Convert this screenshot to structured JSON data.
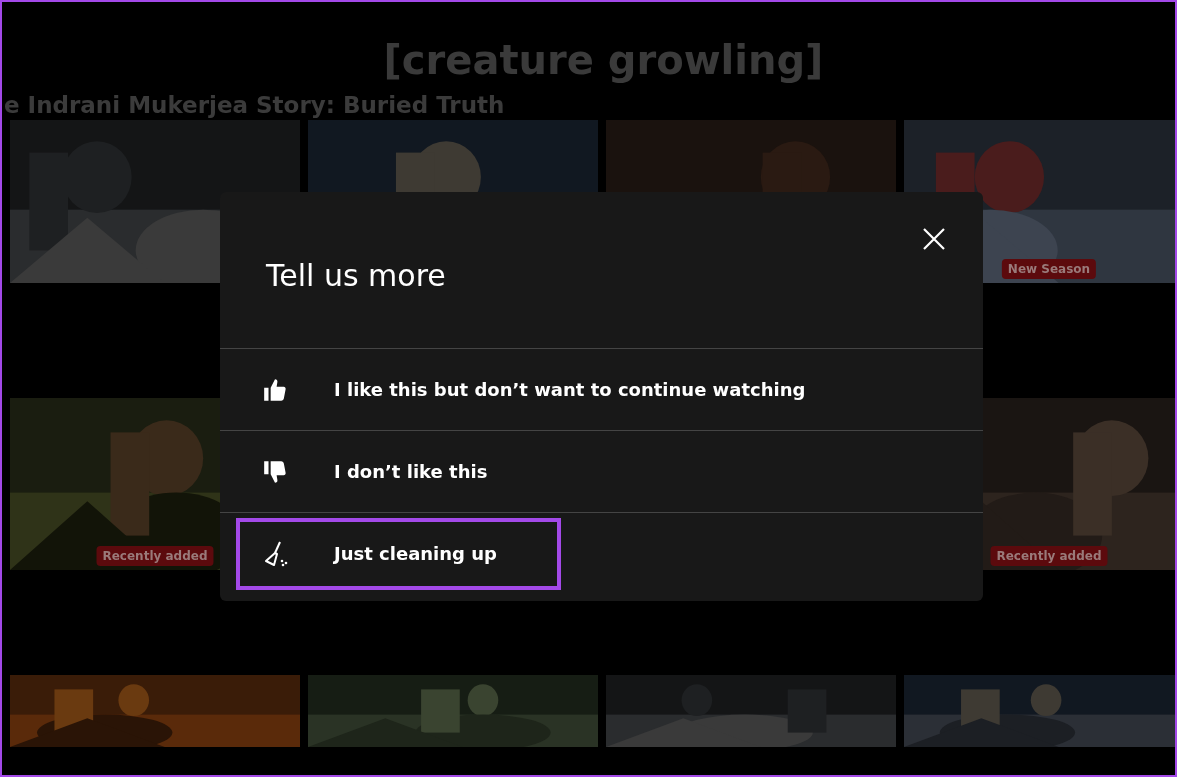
{
  "subtitle": "[creature growling]",
  "row_title": "e Indrani Mukerjea Story: Buried Truth",
  "rows": [
    {
      "tiles": [
        {
          "kind": "picture"
        },
        {
          "kind": "picture"
        },
        {
          "kind": "picture"
        },
        {
          "kind": "picture",
          "badge": "New Season"
        }
      ]
    },
    {
      "tiles": [
        {
          "kind": "picture",
          "badge": "Recently added"
        },
        {
          "kind": "picture",
          "badge": "Recently added"
        }
      ]
    },
    {
      "tiles": [
        {
          "kind": "picture"
        },
        {
          "kind": "picture"
        },
        {
          "kind": "picture"
        },
        {
          "kind": "picture"
        }
      ]
    }
  ],
  "dialog": {
    "title": "Tell us more",
    "options": [
      {
        "kind": "thumbs-up",
        "label": "I like this but don’t want to continue watching",
        "selected": false
      },
      {
        "kind": "thumbs-down",
        "label": "I don’t like this",
        "selected": false
      },
      {
        "kind": "broom",
        "label": "Just cleaning up",
        "selected": true
      }
    ]
  }
}
